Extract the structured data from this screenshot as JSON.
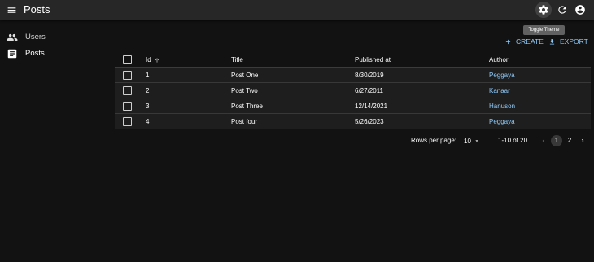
{
  "app_bar": {
    "title": "Posts",
    "menu_icon": "menu-icon",
    "theme_icon": "gear-icon",
    "refresh_icon": "refresh-icon",
    "account_icon": "account-circle-icon",
    "tooltip": "Toggle Theme",
    "background": "#272727"
  },
  "sidebar": {
    "items": [
      {
        "label": "Users",
        "icon": "people-icon",
        "active": false
      },
      {
        "label": "Posts",
        "icon": "book-icon",
        "active": true
      }
    ]
  },
  "toolbar": {
    "create_label": "CREATE",
    "export_label": "EXPORT",
    "accent": "#90caf9"
  },
  "table": {
    "columns": [
      "Id",
      "Title",
      "Published at",
      "Author"
    ],
    "sort_column": "Id",
    "sort_direction": "ascending",
    "rows": [
      {
        "id": "1",
        "title": "Post One",
        "published": "8/30/2019",
        "author": "Peggaya"
      },
      {
        "id": "2",
        "title": "Post Two",
        "published": "6/27/2011",
        "author": "Kanaar"
      },
      {
        "id": "3",
        "title": "Post Three",
        "published": "12/14/2021",
        "author": "Hanuson"
      },
      {
        "id": "4",
        "title": "Post four",
        "published": "5/26/2023",
        "author": "Peggaya"
      }
    ]
  },
  "pagination": {
    "rows_per_page_label": "Rows per page:",
    "rows_per_page_value": "10",
    "range": "1-10 of 20",
    "pages": [
      "1",
      "2"
    ],
    "current_page": "1"
  }
}
